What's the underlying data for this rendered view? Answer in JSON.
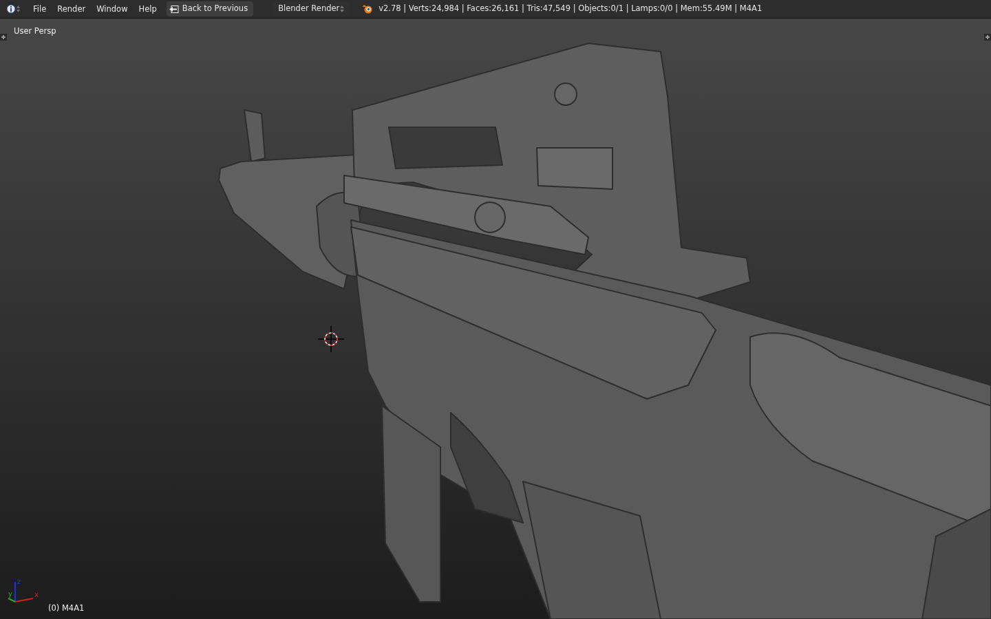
{
  "menu_bar": {
    "menus": [
      "File",
      "Render",
      "Window",
      "Help"
    ],
    "back_button": "Back to Previous",
    "render_engine": "Blender Render",
    "stats": "v2.78 | Verts:24,984 | Faces:26,161 | Tris:47,549 | Objects:0/1 | Lamps:0/0 | Mem:55.49M | M4A1"
  },
  "viewport": {
    "view_label": "User Persp",
    "object_label": "(0) M4A1",
    "axes": [
      {
        "kind": "z",
        "label": "z"
      },
      {
        "kind": "y",
        "label": "y"
      },
      {
        "kind": "x",
        "label": "x"
      }
    ]
  }
}
